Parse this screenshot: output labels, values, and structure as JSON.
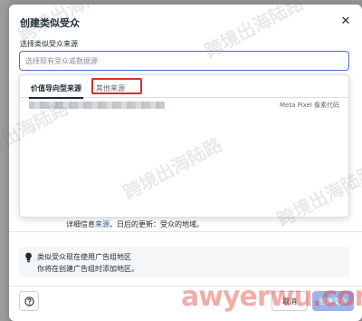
{
  "modal": {
    "title": "创建类似受众",
    "field_label": "选择类似受众来源",
    "search_placeholder": "选择现有受众或数据源"
  },
  "dropdown": {
    "tabs": [
      {
        "label": "价值导向型来源"
      },
      {
        "label": "其他来源"
      }
    ],
    "rows": [
      {
        "type_label": "Meta Pixel 像素代码"
      }
    ]
  },
  "obscured": {
    "text_start": "详细信息",
    "link": "来源",
    "text_end": "。日后的更新：受众的地域。"
  },
  "info": {
    "line1": "类似受众现在使用广告组地区",
    "line2": "你将在创建广告组时添加地区。"
  },
  "footer": {
    "cancel_label": "取消",
    "create_label": "创建受众"
  },
  "watermark": {
    "text": "跨境出海陆路",
    "brand": "awyerwu.com"
  },
  "colors": {
    "accent": "#4a6ed8",
    "primary_disabled": "#9cb4e8",
    "highlight": "#e02b2b"
  }
}
